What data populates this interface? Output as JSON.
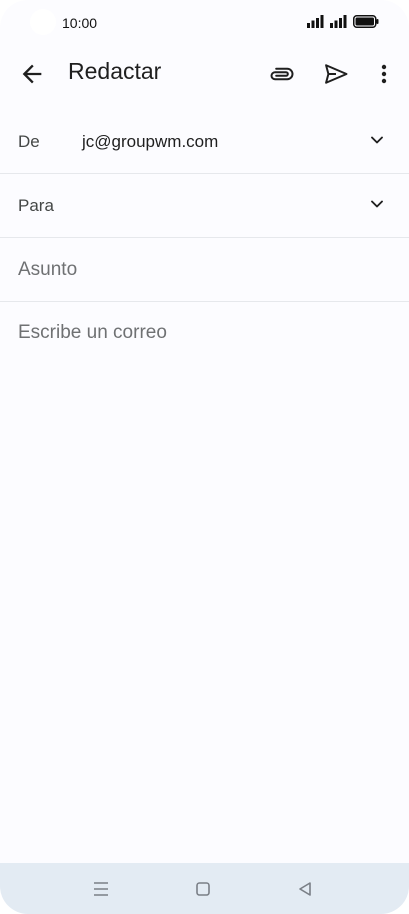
{
  "status": {
    "time": "10:00",
    "icons": [
      "signal-icon",
      "signal-icon",
      "battery-icon"
    ]
  },
  "app_bar": {
    "title": "Redactar",
    "icons": [
      "back-arrow-icon",
      "paperclip-icon",
      "send-icon",
      "more-vert-icon"
    ]
  },
  "compose": {
    "from_label": "De",
    "from_value": "jc@groupwm.com",
    "to_label": "Para",
    "subject_placeholder": "Asunto",
    "body_placeholder": "Escribe un correo"
  },
  "nav": {
    "icons": [
      "menu-icon",
      "home-square-icon",
      "back-triangle-icon"
    ]
  },
  "colors": {
    "background": "#fcfcff",
    "nav_bar": "#e3ebf3",
    "divider": "#e6e8ec",
    "text_primary": "#1f1f1f",
    "text_secondary": "#444746",
    "placeholder": "#6f7173"
  }
}
